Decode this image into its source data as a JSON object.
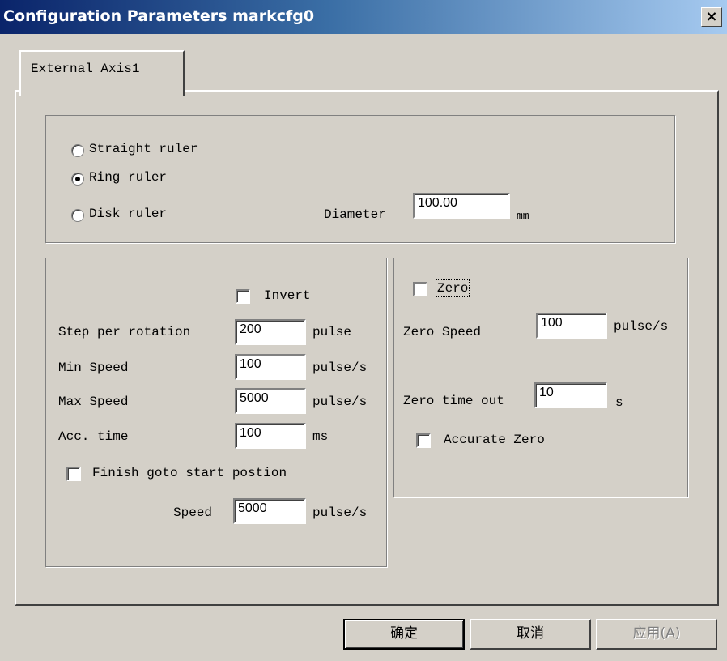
{
  "window": {
    "title": "Configuration Parameters markcfg0",
    "close_label": "×"
  },
  "tab": {
    "label": "External Axis1"
  },
  "ruler": {
    "options": [
      {
        "label": "Straight ruler",
        "selected": false
      },
      {
        "label": "Ring ruler",
        "selected": true
      },
      {
        "label": "Disk ruler",
        "selected": false
      }
    ],
    "diameter_label": "Diameter",
    "diameter_value": "100.00",
    "diameter_unit": "mm"
  },
  "motion": {
    "invert_label": "Invert",
    "invert_checked": false,
    "step_label": "Step per rotation",
    "step_value": "200",
    "step_unit": "pulse",
    "min_speed_label": "Min Speed",
    "min_speed_value": "100",
    "min_speed_unit": "pulse/s",
    "max_speed_label": "Max Speed",
    "max_speed_value": "5000",
    "max_speed_unit": "pulse/s",
    "acc_label": "Acc. time",
    "acc_value": "100",
    "acc_unit": "ms",
    "finish_label": "Finish goto start postion",
    "finish_checked": false,
    "speed_label": "Speed",
    "speed_value": "5000",
    "speed_unit": "pulse/s"
  },
  "zero": {
    "zero_label": "Zero",
    "zero_checked": false,
    "zero_speed_label": "Zero Speed",
    "zero_speed_value": "100",
    "zero_speed_unit": "pulse/s",
    "timeout_label": "Zero time out",
    "timeout_value": "10",
    "timeout_unit": "s",
    "accurate_label": "Accurate Zero",
    "accurate_checked": false
  },
  "buttons": {
    "ok": "确定",
    "cancel": "取消",
    "apply": "应用(A)"
  }
}
